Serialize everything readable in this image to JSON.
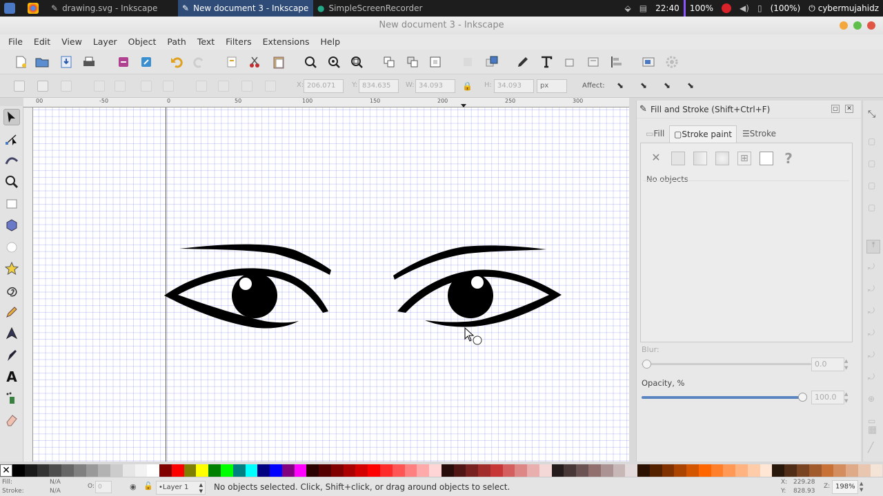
{
  "taskbar": {
    "tasks": [
      {
        "label": "drawing.svg - Inkscape",
        "active": false
      },
      {
        "label": "New document 3 - Inkscape",
        "active": true
      },
      {
        "label": "SimpleScreenRecorder",
        "active": false
      }
    ],
    "tray": {
      "clock": "22:40",
      "brightness": "100%",
      "battery": "(100%)",
      "user": "cybermujahidz"
    }
  },
  "window": {
    "title": "New document 3 - Inkscape"
  },
  "menu": [
    "File",
    "Edit",
    "View",
    "Layer",
    "Object",
    "Path",
    "Text",
    "Filters",
    "Extensions",
    "Help"
  ],
  "controls": {
    "x_value": "206.071",
    "y_value": "834.635",
    "w_label": "W:",
    "w_value": "34.093",
    "h_label": "H:",
    "h_value": "34.093",
    "unit": "px",
    "affect_label": "Affect:"
  },
  "ruler": {
    "ticks": [
      "00",
      "-50",
      "0",
      "50",
      "100",
      "150",
      "200",
      "250",
      "300"
    ]
  },
  "panel": {
    "title": "Fill and Stroke (Shift+Ctrl+F)",
    "tabs": [
      "Fill",
      "Stroke paint",
      "Stroke style"
    ],
    "active_tab": "Stroke paint",
    "empty_message": "No objects",
    "blur_label": "Blur:",
    "blur_value": "0.0",
    "opacity_label": "Opacity, %",
    "opacity_value": "100.0",
    "opacity_level": 1.0
  },
  "status": {
    "fill_label": "Fill:",
    "fill_value": "N/A",
    "stroke_label": "Stroke:",
    "stroke_value": "N/A",
    "opacity_label": "O:",
    "opacity_value": "0",
    "layer": "•Layer 1",
    "message": "No objects selected. Click, Shift+click, or drag around objects to select.",
    "x_label": "X:",
    "x_coord": "229.28",
    "y_label": "Y:",
    "y_coord": "828.93",
    "zoom_label": "Z:",
    "zoom": "198%"
  },
  "palette_colors": [
    "#000000",
    "#1a1a1a",
    "#333333",
    "#4d4d4d",
    "#666666",
    "#808080",
    "#999999",
    "#b3b3b3",
    "#cccccc",
    "#e6e6e6",
    "#f2f2f2",
    "#ffffff",
    "#800000",
    "#ff0000",
    "#808000",
    "#ffff00",
    "#008000",
    "#00ff00",
    "#008080",
    "#00ffff",
    "#000080",
    "#0000ff",
    "#800080",
    "#ff00ff",
    "#2b0000",
    "#550000",
    "#800000",
    "#aa0000",
    "#d40000",
    "#ff0000",
    "#ff2a2a",
    "#ff5555",
    "#ff8080",
    "#ffaaaa",
    "#ffd5d5",
    "#280b0b",
    "#501616",
    "#782121",
    "#a02c2c",
    "#c83737",
    "#d35f5f",
    "#de8787",
    "#e9afaf",
    "#f4d7d7",
    "#241c1c",
    "#483737",
    "#6c5353",
    "#916f6f",
    "#ac9393",
    "#c8b7b7",
    "#e3dbdb",
    "#2b1100",
    "#552200",
    "#803300",
    "#aa4400",
    "#d45500",
    "#ff6600",
    "#ff7f2a",
    "#ff9955",
    "#ffb380",
    "#ffccaa",
    "#ffe6d5",
    "#28170b",
    "#502d16",
    "#784421",
    "#a05a2c",
    "#c87137",
    "#d38d5f",
    "#deaa87",
    "#e9c6af",
    "#f4e3d7"
  ]
}
